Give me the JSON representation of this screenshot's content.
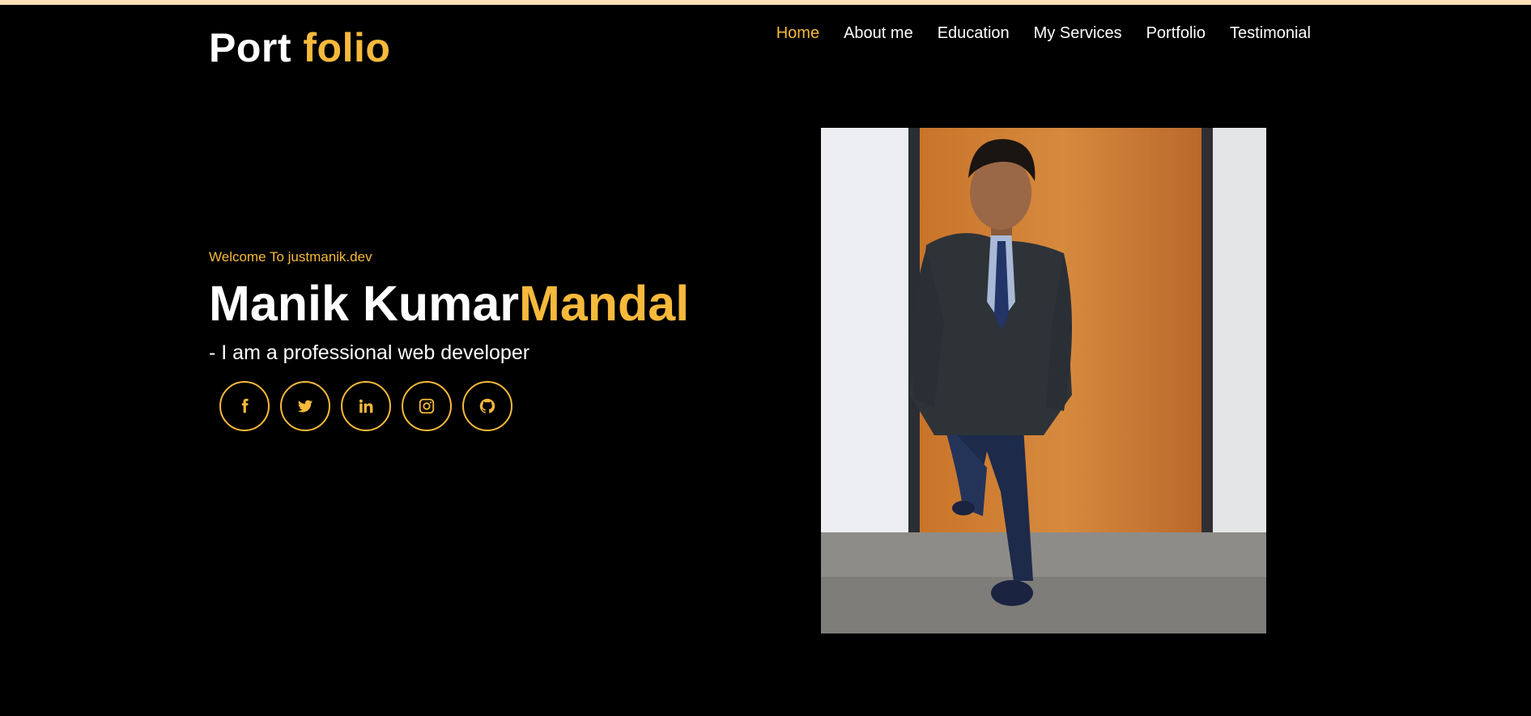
{
  "header": {
    "logo_main": "Port",
    "logo_accent": "folio"
  },
  "nav": {
    "items": [
      {
        "label": "Home",
        "active": true
      },
      {
        "label": "About me"
      },
      {
        "label": "Education"
      },
      {
        "label": "My Services"
      },
      {
        "label": "Portfolio"
      },
      {
        "label": "Testimonial"
      }
    ]
  },
  "hero": {
    "welcome": "Welcome To justmanik.dev",
    "first_name": "Manik Kumar",
    "last_name": "Mandal",
    "tagline": "- I am a professional web developer",
    "socials": [
      {
        "icon": "facebook-icon"
      },
      {
        "icon": "twitter-icon"
      },
      {
        "icon": "linkedin-icon"
      },
      {
        "icon": "instagram-icon"
      },
      {
        "icon": "github-icon"
      }
    ]
  },
  "colors": {
    "accent": "#f6b93b",
    "background": "#000000",
    "top_strip": "#fbe0b8"
  }
}
